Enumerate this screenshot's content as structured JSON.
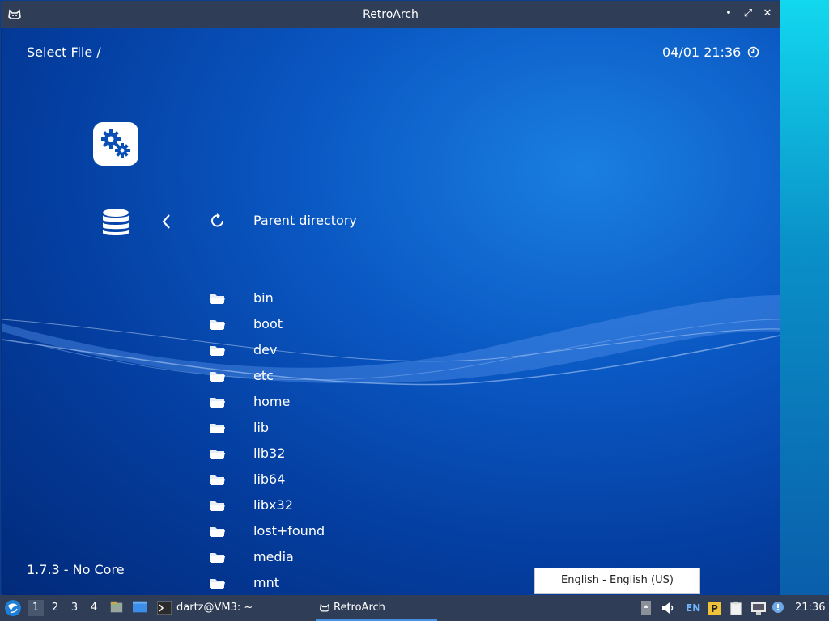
{
  "window": {
    "title": "RetroArch",
    "minimize_glyph": "•",
    "restore_glyph": "⤢",
    "close_glyph": "✕"
  },
  "header": {
    "title": "Select File /",
    "datetime": "04/01 21:36"
  },
  "nav": {
    "parent": "Parent directory"
  },
  "files": [
    "bin",
    "boot",
    "dev",
    "etc",
    "home",
    "lib",
    "lib32",
    "lib64",
    "libx32",
    "lost+found",
    "media",
    "mnt"
  ],
  "footer": {
    "version": "1.7.3 - No Core"
  },
  "language_popup": {
    "text": "English - English (US)"
  },
  "taskbar": {
    "workspaces": [
      "1",
      "2",
      "3",
      "4"
    ],
    "terminal_task": "dartz@VM3: ~",
    "retroarch_task": "RetroArch",
    "keyboard_layout": "EN",
    "clock": "21:36"
  },
  "colors": {
    "accent": "#0a57c2",
    "titlebar": "#2f3e56",
    "text": "#ffffff"
  }
}
